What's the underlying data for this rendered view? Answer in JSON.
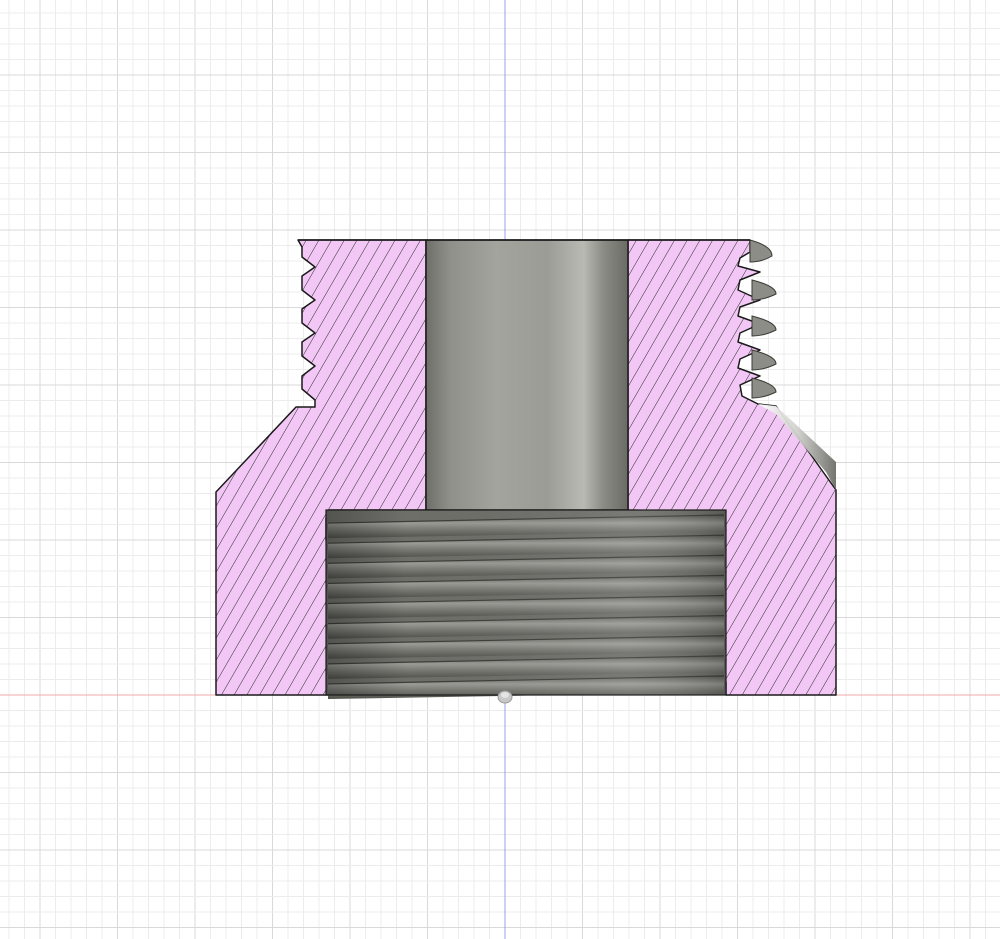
{
  "viewport": {
    "mode": "section-analysis",
    "grid": true,
    "axes": {
      "vertical_axis_color": "#9c9cf2",
      "horizontal_axis_color": "#f2a8a8"
    }
  },
  "colors": {
    "background": "#ffffff",
    "grid_minor": "#ececec",
    "grid_major": "#d9d9d9",
    "section_fill": "#f3c7f5",
    "hatch": "#2a2a2a",
    "outline": "#1a1a1a",
    "bore_base": "#9a9b92",
    "thread_base": "#7d7d76"
  },
  "model": {
    "part": "threaded-adapter",
    "section_hatched": true,
    "top_external_thread_turns": 5,
    "bottom_internal_thread_turns": 9
  },
  "icons": {
    "origin_marker": "origin-point-icon"
  }
}
